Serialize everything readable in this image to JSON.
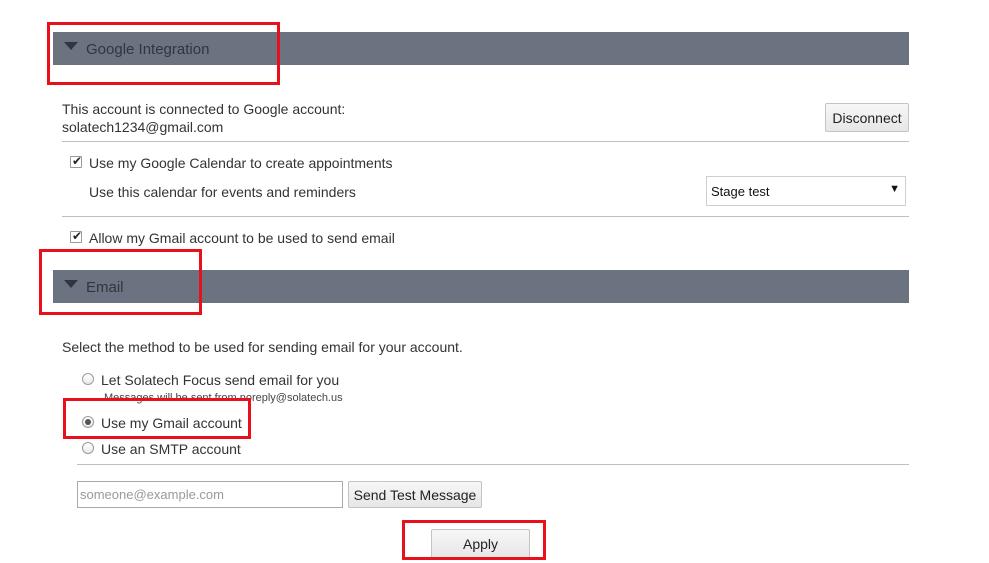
{
  "google_section": {
    "title": "Google Integration",
    "connected_text": "This account is connected to Google account:",
    "account_email": "solatech1234@gmail.com",
    "disconnect_label": "Disconnect",
    "calendar_checkbox_label": "Use my Google Calendar to create appointments",
    "calendar_checked": true,
    "calendar_select_label": "Use this calendar for events and reminders",
    "calendar_selected": "Stage test",
    "gmail_checkbox_label": "Allow my Gmail account to be used to send email",
    "gmail_checked": true
  },
  "email_section": {
    "title": "Email",
    "method_prompt": "Select the method to be used for sending email for your account.",
    "options": [
      {
        "label": "Let Solatech Focus send email for you",
        "sublabel": "Messages will be sent from noreply@solatech.us",
        "checked": false
      },
      {
        "label": "Use my Gmail account",
        "checked": true
      },
      {
        "label": "Use an SMTP account",
        "checked": false
      }
    ],
    "test_email_placeholder": "someone@example.com",
    "send_test_label": "Send Test Message",
    "apply_label": "Apply"
  },
  "icons": {
    "check": "✔",
    "dropdown_arrow": "▼"
  },
  "colors": {
    "section_header_bg": "#6b7380",
    "highlight_red": "#e8101a"
  }
}
